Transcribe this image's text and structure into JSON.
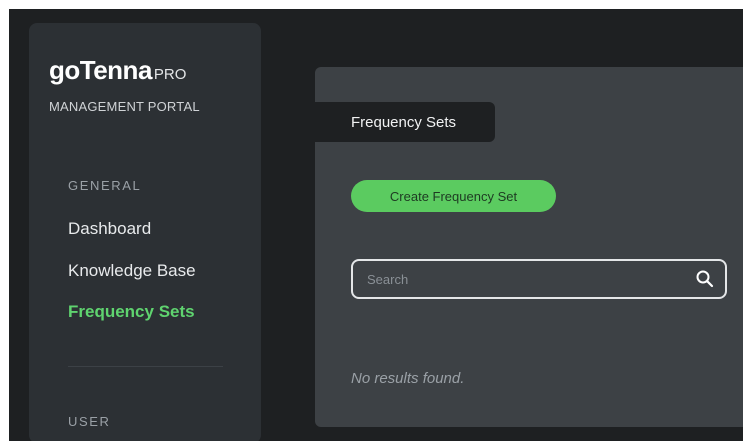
{
  "brand": {
    "logo": "goTenna",
    "pro": "PRO",
    "subtitle": "MANAGEMENT PORTAL"
  },
  "sidebar": {
    "sections": [
      {
        "label": "GENERAL",
        "items": [
          {
            "label": "Dashboard",
            "active": false
          },
          {
            "label": "Knowledge Base",
            "active": false
          },
          {
            "label": "Frequency Sets",
            "active": true
          }
        ]
      },
      {
        "label": "USER",
        "items": []
      }
    ]
  },
  "main": {
    "tab": "Frequency Sets",
    "create_button": "Create Frequency Set",
    "search": {
      "placeholder": "Search",
      "value": ""
    },
    "empty_message": "No results found."
  },
  "colors": {
    "accent": "#5bcb60",
    "active_nav": "#5fd36f",
    "background": "#1e2022",
    "sidebar": "#2c3034",
    "panel": "#3d4145"
  },
  "icons": {
    "search": "search-icon"
  }
}
